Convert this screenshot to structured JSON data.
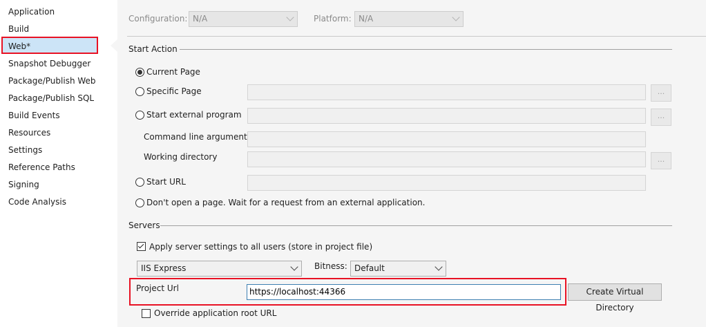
{
  "sidebar": {
    "items": [
      {
        "label": "Application"
      },
      {
        "label": "Build"
      },
      {
        "label": "Web*"
      },
      {
        "label": "Snapshot Debugger"
      },
      {
        "label": "Package/Publish Web"
      },
      {
        "label": "Package/Publish SQL"
      },
      {
        "label": "Build Events"
      },
      {
        "label": "Resources"
      },
      {
        "label": "Settings"
      },
      {
        "label": "Reference Paths"
      },
      {
        "label": "Signing"
      },
      {
        "label": "Code Analysis"
      }
    ]
  },
  "toolbar": {
    "configuration_label": "Configuration:",
    "configuration_value": "N/A",
    "platform_label": "Platform:",
    "platform_value": "N/A"
  },
  "start_action": {
    "title": "Start Action",
    "current_page": "Current Page",
    "specific_page": "Specific Page",
    "start_external_program": "Start external program",
    "command_line_arguments": "Command line arguments",
    "working_directory": "Working directory",
    "start_url": "Start URL",
    "dont_open": "Don't open a page.  Wait for a request from an external application.",
    "browse": "..."
  },
  "servers": {
    "title": "Servers",
    "apply_settings": "Apply server settings to all users (store in project file)",
    "server_value": "IIS Express",
    "bitness_label": "Bitness:",
    "bitness_value": "Default",
    "project_url_label": "Project Url",
    "project_url_value": "https://localhost:44366",
    "create_virtual_directory": "Create Virtual Directory",
    "override_root": "Override application root URL"
  }
}
